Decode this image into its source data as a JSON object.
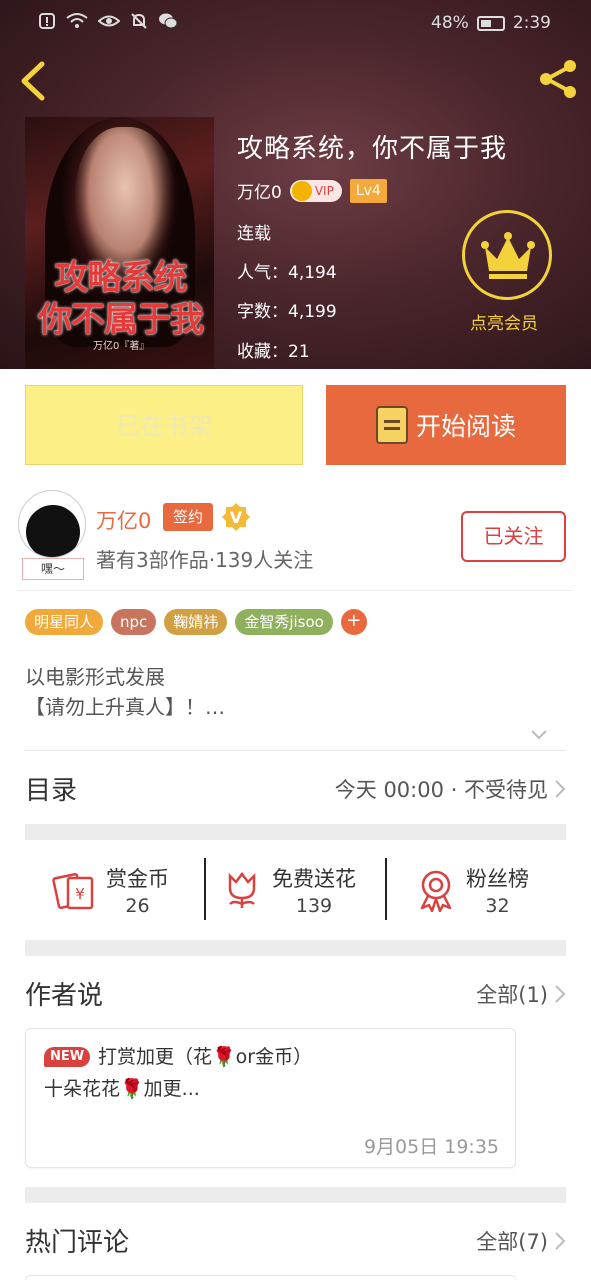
{
  "status_bar": {
    "battery": "48%",
    "time": "2:39"
  },
  "book": {
    "title": "攻略系统，你不属于我",
    "author": "万亿0",
    "vip_label": "VIP",
    "level": "Lv4",
    "status": "连载",
    "popularity_label": "人气：",
    "popularity": "4,194",
    "words_label": "字数：",
    "words": "4,199",
    "favorites_label": "收藏：",
    "favorites": "21",
    "vip_cta": "点亮会员",
    "cover": {
      "title_line1": "攻略系统",
      "title_line2": "你不属于我",
      "author_mark": "万亿0『著』"
    }
  },
  "actions": {
    "shelf": "已在书架",
    "read": "开始阅读"
  },
  "author": {
    "name": "万亿0",
    "sign_badge": "签约",
    "v_badge": "V",
    "avatar_tag": "嘿～",
    "works": "著有3部作品·139人关注",
    "follow": "已关注"
  },
  "tags": [
    {
      "label": "明星同人",
      "color": "#f2a93b"
    },
    {
      "label": "npc",
      "color": "#c9745e"
    },
    {
      "label": "鞠婧祎",
      "color": "#d1a042"
    },
    {
      "label": "金智秀jisoo",
      "color": "#8fb05c"
    }
  ],
  "tag_more": "+",
  "description": {
    "line1": "以电影形式发展",
    "line2": "【请勿上升真人】！…"
  },
  "catalog": {
    "title": "目录",
    "info": "今天 00:00 · 不受待见"
  },
  "rewards": [
    {
      "label": "赏金币",
      "count": "26",
      "icon": "coin-envelope-icon"
    },
    {
      "label": "免费送花",
      "count": "139",
      "icon": "flower-icon"
    },
    {
      "label": "粉丝榜",
      "count": "32",
      "icon": "ribbon-icon"
    }
  ],
  "author_says": {
    "title": "作者说",
    "all": "全部(1)",
    "note": {
      "badge": "NEW",
      "line1": "打赏加更（花🌹or金币）",
      "line2": "十朵花花🌹加更...",
      "date": "9月05日  19:35"
    }
  },
  "hot_comments": {
    "title": "热门评论",
    "all": "全部(7)"
  },
  "colors": {
    "accent": "#e8693e",
    "red": "#d9413f",
    "gold": "#f3d23c",
    "shelf_bg": "#fbef86"
  }
}
